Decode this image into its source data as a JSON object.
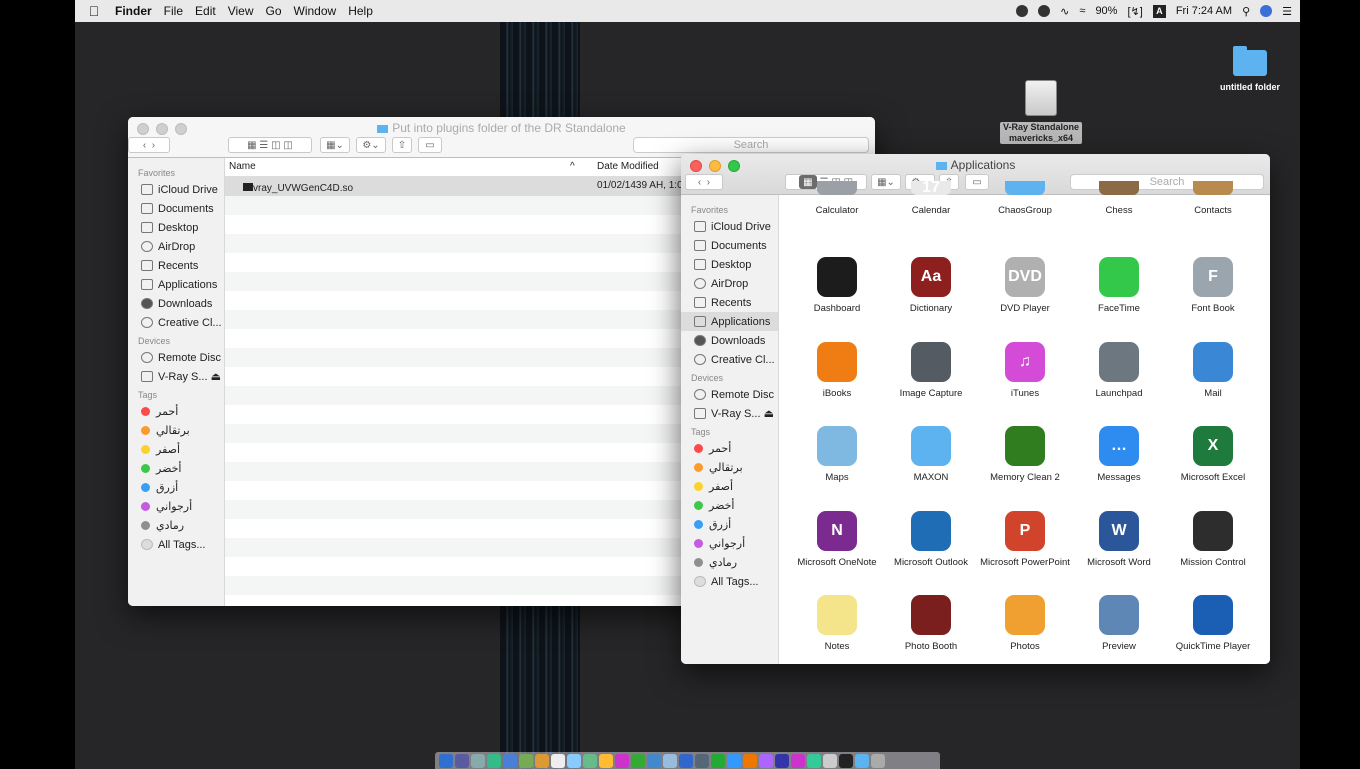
{
  "menubar": {
    "app": "Finder",
    "items": [
      "File",
      "Edit",
      "View",
      "Go",
      "Window",
      "Help"
    ],
    "battery": "90%",
    "input_source": "A",
    "clock": "Fri 7:24 AM"
  },
  "desktop": {
    "folder_label": "untitled folder",
    "disk_label_line1": "V-Ray Standalone",
    "disk_label_line2": "mavericks_x64"
  },
  "left_window": {
    "title": "Put into plugins folder of the DR Standalone",
    "search_placeholder": "Search",
    "col_name": "Name",
    "col_date": "Date Modified",
    "sort_indicator": "^",
    "file_name": "libvray_UVWGenC4D.so",
    "file_date": "01/02/1439 AH, 1:0",
    "favorites_head": "Favorites",
    "favorites": [
      "iCloud Drive",
      "Documents",
      "Desktop",
      "AirDrop",
      "Recents",
      "Applications",
      "Downloads",
      "Creative Cl..."
    ],
    "devices_head": "Devices",
    "devices": [
      "Remote Disc",
      "V-Ray S... ⏏"
    ],
    "tags_head": "Tags",
    "tags": [
      {
        "label": "أحمر",
        "color": "#fc4a4a"
      },
      {
        "label": "برتقالي",
        "color": "#fd9a2a"
      },
      {
        "label": "أصفر",
        "color": "#fdd12d"
      },
      {
        "label": "أخضر",
        "color": "#3ec84a"
      },
      {
        "label": "أزرق",
        "color": "#3a9ef5"
      },
      {
        "label": "أرجواني",
        "color": "#c45be0"
      },
      {
        "label": "رمادي",
        "color": "#8f8f8f"
      }
    ],
    "all_tags": "All Tags..."
  },
  "right_window": {
    "title": "Applications",
    "search_placeholder": "Search",
    "favorites_head": "Favorites",
    "favorites": [
      "iCloud Drive",
      "Documents",
      "Desktop",
      "AirDrop",
      "Recents",
      "Applications",
      "Downloads",
      "Creative Cl..."
    ],
    "devices_head": "Devices",
    "devices": [
      "Remote Disc",
      "V-Ray S... ⏏"
    ],
    "tags_head": "Tags",
    "tags": [
      {
        "label": "أحمر",
        "color": "#fc4a4a"
      },
      {
        "label": "برتقالي",
        "color": "#fd9a2a"
      },
      {
        "label": "أصفر",
        "color": "#fdd12d"
      },
      {
        "label": "أخضر",
        "color": "#3ec84a"
      },
      {
        "label": "أزرق",
        "color": "#3a9ef5"
      },
      {
        "label": "أرجواني",
        "color": "#c45be0"
      },
      {
        "label": "رمادي",
        "color": "#8f8f8f"
      }
    ],
    "all_tags": "All Tags...",
    "apps": [
      [
        "Calculator",
        "Calendar",
        "ChaosGroup",
        "Chess",
        "Contacts"
      ],
      [
        "Dashboard",
        "Dictionary",
        "DVD Player",
        "FaceTime",
        "Font Book"
      ],
      [
        "iBooks",
        "Image Capture",
        "iTunes",
        "Launchpad",
        "Mail"
      ],
      [
        "Maps",
        "MAXON",
        "Memory Clean 2",
        "Messages",
        "Microsoft Excel"
      ],
      [
        "Microsoft OneNote",
        "Microsoft Outlook",
        "Microsoft PowerPoint",
        "Microsoft Word",
        "Mission Control"
      ],
      [
        "Notes",
        "Photo Booth",
        "Photos",
        "Preview",
        "QuickTime Player"
      ]
    ],
    "app_colors": [
      [
        "#9aa0a6",
        "#e9e9e9",
        "#5cb3f0",
        "#8b6a45",
        "#b98a4e"
      ],
      [
        "#1c1c1c",
        "#8e1f1f",
        "#b0b0b0",
        "#34c84a",
        "#9aa5ad"
      ],
      [
        "#ef7d14",
        "#555b63",
        "#d34bd6",
        "#6d7780",
        "#3a87d6"
      ],
      [
        "#7fb8e0",
        "#5cb3f0",
        "#2f7d1f",
        "#2e8cf0",
        "#1e7a3d"
      ],
      [
        "#7b2b8f",
        "#1e6db5",
        "#d2432b",
        "#2b579a",
        "#2d2d2d"
      ],
      [
        "#f4e48a",
        "#7a1e1e",
        "#f0a030",
        "#5f87b5",
        "#1a5fb4"
      ]
    ],
    "app_glyphs": [
      [
        "",
        "17",
        "",
        "",
        ""
      ],
      [
        "",
        "Aa",
        "DVD",
        "",
        "F"
      ],
      [
        "",
        "",
        "♫",
        "",
        ""
      ],
      [
        "",
        "",
        "",
        "…",
        "X"
      ],
      [
        "N",
        "",
        "P",
        "W",
        ""
      ],
      [
        "",
        "",
        "",
        "",
        ""
      ]
    ]
  },
  "dock": {
    "colors": [
      "#2f6fd0",
      "#5a5aa0",
      "#8aa",
      "#3b8",
      "#4a7fd8",
      "#7a5",
      "#d93",
      "#eee",
      "#8cf",
      "#6b8",
      "#fb3",
      "#c3c",
      "#3a3",
      "#48c",
      "#9bd",
      "#36c",
      "#567",
      "#2a3",
      "#39f",
      "#e70",
      "#a6f",
      "#33a",
      "#c3c",
      "#3c9",
      "#ccc",
      "#222",
      "#5cb3f0",
      "#aaa"
    ]
  }
}
